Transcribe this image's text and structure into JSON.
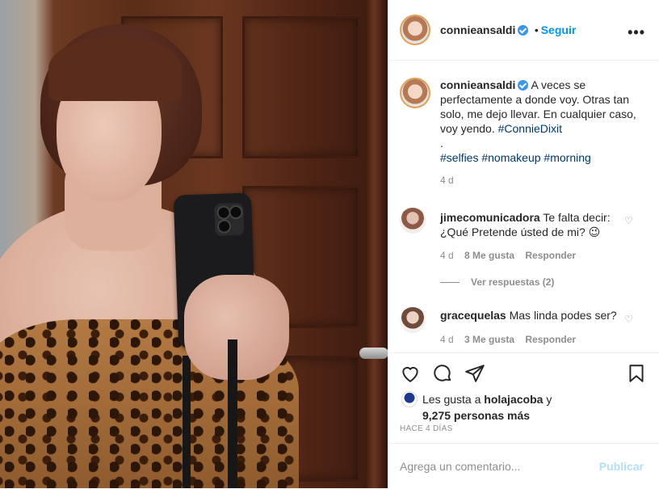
{
  "post": {
    "username": "connieansaldi",
    "follow_label": "Seguir",
    "more_label": "•••"
  },
  "caption": {
    "username": "connieansaldi",
    "text": "A veces se perfectamente a donde voy. Otras tan solo, me dejo llevar. En cualquier caso, voy yendo.",
    "hashtag_main": "#ConnieDixit",
    "separator": ".",
    "hashtags": [
      "#selfies",
      "#nomakeup",
      "#morning"
    ],
    "time": "4 d"
  },
  "comments": [
    {
      "username": "jimecomunicadora",
      "text": "Te falta decir: ¿Qué Pretende ústed de mi? 😉",
      "time": "4 d",
      "likes": "8 Me gusta",
      "reply": "Responder",
      "view_replies": "Ver respuestas (2)"
    },
    {
      "username": "gracequelas",
      "text": "Mas linda podes ser?",
      "time": "4 d",
      "likes": "3 Me gusta",
      "reply": "Responder"
    }
  ],
  "likes": {
    "prefix": "Les gusta a",
    "user": "holajacoba",
    "conj": "y",
    "others": "9,275 personas más"
  },
  "posted_ago": "HACE 4 DÍAS",
  "add_comment": {
    "placeholder": "Agrega un comentario...",
    "publish": "Publicar"
  },
  "icons": [
    "verified-badge-icon",
    "heart-icon",
    "comment-icon",
    "share-icon",
    "save-icon",
    "more-options-icon"
  ],
  "colors": {
    "accent": "#0095f6",
    "hashtag": "#00376b",
    "muted": "#8e8e8e",
    "verified": "#3897f0"
  }
}
